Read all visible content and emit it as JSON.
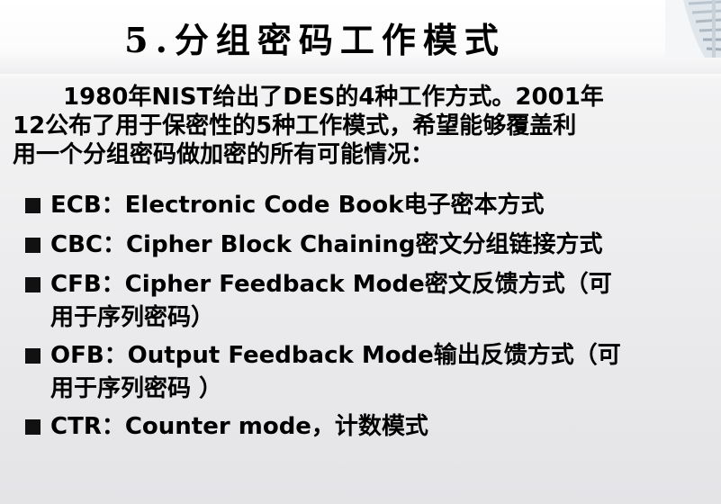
{
  "slide": {
    "title": "5.分组密码工作模式",
    "intro_lines": [
      "1980年NIST给出了DES的4种工作方式。2001年",
      "12公布了用于保密性的5种工作模式，希望能够覆盖利",
      "用一个分组密码做加密的所有可能情况："
    ],
    "bullets": [
      {
        "lines": [
          "ECB：Electronic Code Book电子密本方式"
        ]
      },
      {
        "lines": [
          "CBC：Cipher Block Chaining密文分组链接方式"
        ]
      },
      {
        "lines": [
          "CFB：Cipher Feedback Mode密文反馈方式（可",
          "用于序列密码）"
        ]
      },
      {
        "lines": [
          "OFB：Output Feedback Mode输出反馈方式（可",
          "用于序列密码 ）"
        ]
      },
      {
        "lines": [
          "CTR：Counter mode，计数模式"
        ]
      }
    ]
  },
  "colors": {
    "text": "#000000",
    "bullet_square": "#111111",
    "background": "#ececee"
  }
}
